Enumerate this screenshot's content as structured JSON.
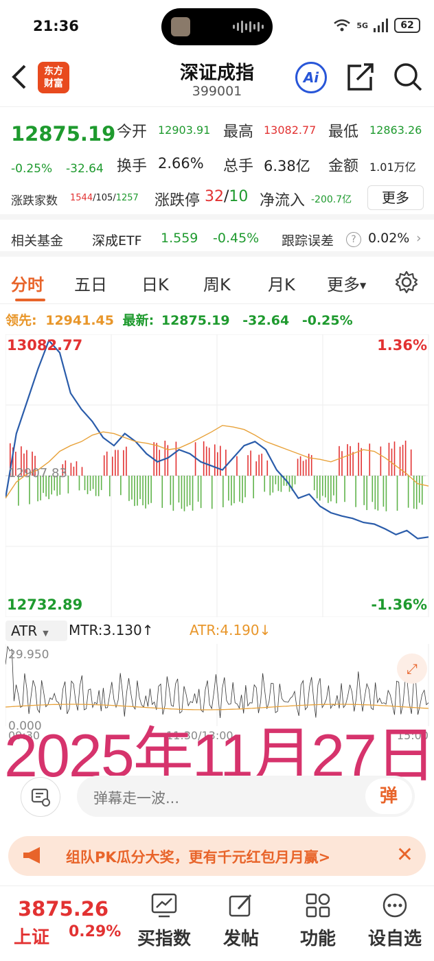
{
  "status_bar": {
    "time": "21:36",
    "network": "5G",
    "battery": "62"
  },
  "header": {
    "back_icon": "chevron-left-icon",
    "logo_text_1": "东方",
    "logo_text_2": "财富",
    "title": "深证成指",
    "code": "399001",
    "ai_label": "Ai"
  },
  "quote": {
    "price": "12875.19",
    "pct": "-0.25%",
    "change": "-32.64",
    "open_label": "今开",
    "open": "12903.91",
    "high_label": "最高",
    "high": "13082.77",
    "low_label": "最低",
    "low": "12863.26",
    "turnover_label": "换手",
    "turnover": "2.66%",
    "volume_label": "总手",
    "volume": "6.38亿",
    "amount_label": "金额",
    "amount": "1.01万亿",
    "breadth_label": "涨跌家数",
    "breadth_up": "1544",
    "breadth_flat": "105",
    "breadth_down": "1257",
    "breadth_sep": "/",
    "limit_label": "涨跌停",
    "limit_up": "32",
    "limit_down": "10",
    "inflow_label": "净流入",
    "inflow": "-200.7亿",
    "more": "更多"
  },
  "fund": {
    "label": "相关基金",
    "name": "深成ETF",
    "price": "1.559",
    "pct": "-0.45%",
    "err_label": "跟踪误差",
    "err_value": "0.02%"
  },
  "tabs": [
    "分时",
    "五日",
    "日K",
    "周K",
    "月K",
    "更多"
  ],
  "legend": {
    "lead_label": "领先:",
    "lead_value": "12941.45",
    "latest_label": "最新:",
    "latest_value": "12875.19",
    "change": "-32.64",
    "pct": "-0.25%"
  },
  "chart_labels": {
    "top_price": "13082.77",
    "bottom_price": "12732.89",
    "top_pct": "1.36%",
    "bottom_pct": "-1.36%",
    "mid_price": "12907.83"
  },
  "atr": {
    "selector": "ATR",
    "mtr": "MTR:3.130↑",
    "atr_value": "ATR:4.190↓",
    "top": "29.950",
    "bottom": "0.000",
    "time_start": "09:30",
    "time_mid": "11:30/13:00",
    "time_end": "15:00"
  },
  "date_overlay": "2025年11月27日",
  "comment": {
    "placeholder": "弹幕走一波...",
    "danmu": "弹"
  },
  "promo": {
    "text": "组队PK瓜分大奖，更有千元红包月月赢>"
  },
  "bottom_bar": {
    "index_value": "3875.26",
    "index_name": "上证",
    "index_pct": "0.29%",
    "items": [
      "买指数",
      "发帖",
      "功能",
      "设自选"
    ]
  },
  "colors": {
    "up": "#e23232",
    "down": "#1e9a2e",
    "accent": "#e8642a",
    "price_line": "#2a5caa",
    "avg_line": "#e8a23a"
  },
  "chart_data": {
    "type": "line",
    "title": "深证成指 分时",
    "xlabel": "",
    "ylabel": "",
    "ylim": [
      12732.89,
      13082.77
    ],
    "x_ticks": [
      "09:30",
      "11:30/13:00",
      "15:00"
    ],
    "series": [
      {
        "name": "最新",
        "values": [
          12880,
          12960,
          13000,
          13040,
          13075,
          13060,
          13010,
          12990,
          12975,
          12955,
          12945,
          12960,
          12950,
          12935,
          12925,
          12930,
          12940,
          12935,
          12925,
          12920,
          12915,
          12930,
          12945,
          12950,
          12940,
          12915,
          12900,
          12880,
          12885,
          12870,
          12862,
          12858,
          12855,
          12850,
          12848,
          12842,
          12835,
          12840,
          12830,
          12832
        ]
      },
      {
        "name": "领先",
        "values": [
          12880,
          12900,
          12910,
          12915,
          12925,
          12938,
          12945,
          12950,
          12958,
          12962,
          12960,
          12955,
          12950,
          12948,
          12945,
          12940,
          12942,
          12948,
          12955,
          12962,
          12970,
          12968,
          12965,
          12958,
          12950,
          12945,
          12940,
          12935,
          12930,
          12928,
          12925,
          12930,
          12935,
          12940,
          12938,
          12930,
          12920,
          12910,
          12898,
          12895
        ]
      }
    ]
  }
}
